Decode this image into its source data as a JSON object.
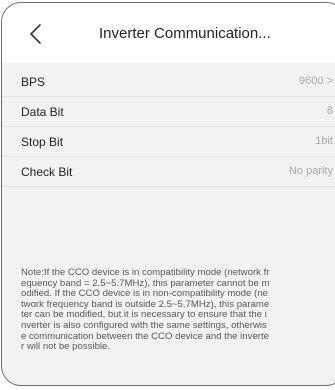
{
  "header": {
    "title": "Inverter Communication..."
  },
  "settings": [
    {
      "label": "BPS",
      "value": "9600 >"
    },
    {
      "label": "Data Bit",
      "value": "8"
    },
    {
      "label": "Stop Bit",
      "value": "1bit"
    },
    {
      "label": "Check Bit",
      "value": "No parity"
    }
  ],
  "note": "Note:If the CCO device is in compatibility mode (network fr\nequency band = 2.5~5.7MHz), this parameter cannot be m\nodified. If the CCO device is in non-compatibility mode (ne\ntwork frequency band is outside 2.5~5.7MHz), this parame\nter can be modified, but it is necessary to ensure that the i\nnverter is also configured with the same settings, otherwis\ne communication between the CCO device and the inverte\nr will not be possible."
}
